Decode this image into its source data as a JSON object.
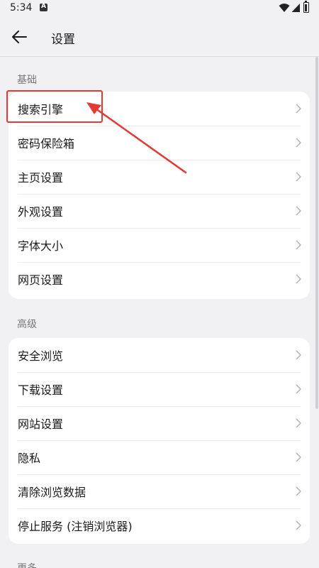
{
  "status_bar": {
    "time": "5:34"
  },
  "header": {
    "title": "设置"
  },
  "sections": [
    {
      "label": "基础",
      "items": [
        {
          "label": "搜索引擎"
        },
        {
          "label": "密码保险箱"
        },
        {
          "label": "主页设置"
        },
        {
          "label": "外观设置"
        },
        {
          "label": "字体大小"
        },
        {
          "label": "网页设置"
        }
      ]
    },
    {
      "label": "高级",
      "items": [
        {
          "label": "安全浏览"
        },
        {
          "label": "下载设置"
        },
        {
          "label": "网站设置"
        },
        {
          "label": "隐私"
        },
        {
          "label": "清除浏览数据"
        },
        {
          "label": "停止服务 (注销浏览器)"
        }
      ]
    },
    {
      "label": "更多"
    }
  ],
  "colors": {
    "highlight": "#e53935",
    "background": "#f1f1f3",
    "card": "#ffffff"
  }
}
